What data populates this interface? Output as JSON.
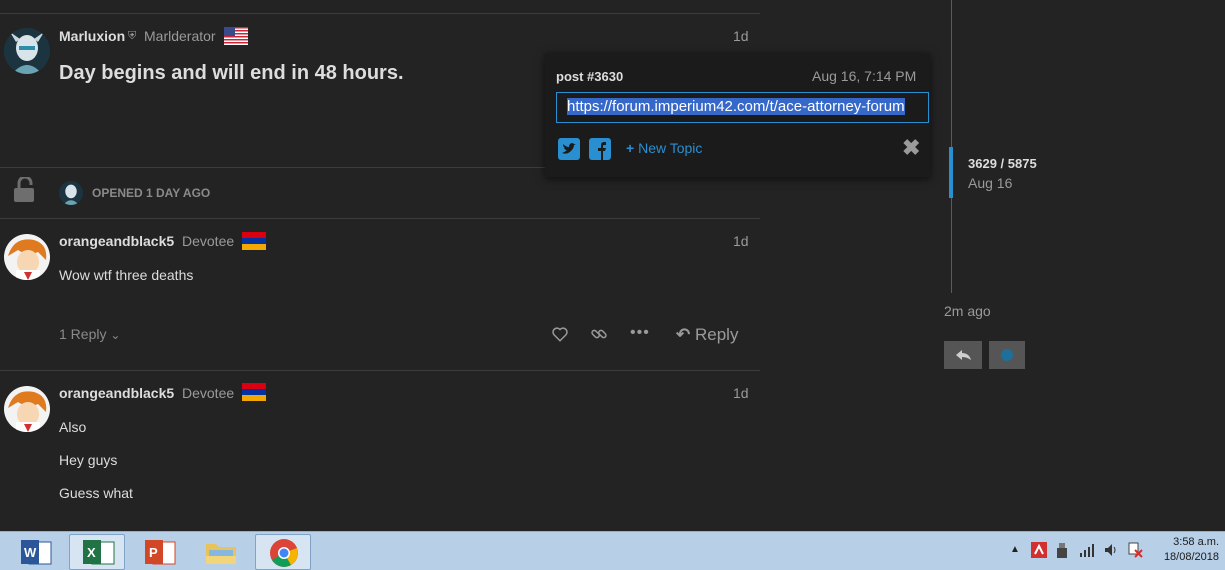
{
  "posts": [
    {
      "username": "Marluxion",
      "title": "Marlderator",
      "age": "1d",
      "body": [
        "Day begins and will end in 48 hours."
      ]
    },
    {
      "username": "orangeandblack5",
      "title": "Devotee",
      "age": "1d",
      "body": [
        "Wow wtf three deaths"
      ],
      "replies_label": "1 Reply",
      "reply_label": "Reply"
    },
    {
      "username": "orangeandblack5",
      "title": "Devotee",
      "age": "1d",
      "body": [
        "Also",
        "Hey guys",
        "Guess what"
      ]
    }
  ],
  "small_action": {
    "text": "OPENED 1 DAY AGO"
  },
  "share_popup": {
    "post_label": "post #3630",
    "date": "Aug 16, 7:14 PM",
    "url": "https://forum.imperium42.com/t/ace-attorney-forum",
    "new_topic_label": "New Topic"
  },
  "timeline": {
    "position": "3629 / 5875",
    "date": "Aug 16",
    "last_activity": "2m ago"
  },
  "taskbar": {
    "apps": [
      "word-icon",
      "excel-icon",
      "powerpoint-icon",
      "file-explorer-icon",
      "chrome-icon"
    ],
    "time": "3:58 a.m.",
    "date": "18/08/2018"
  },
  "colors": {
    "background": "#232323",
    "accent": "#2a8fd0",
    "taskbar": "#b7cfe7"
  }
}
